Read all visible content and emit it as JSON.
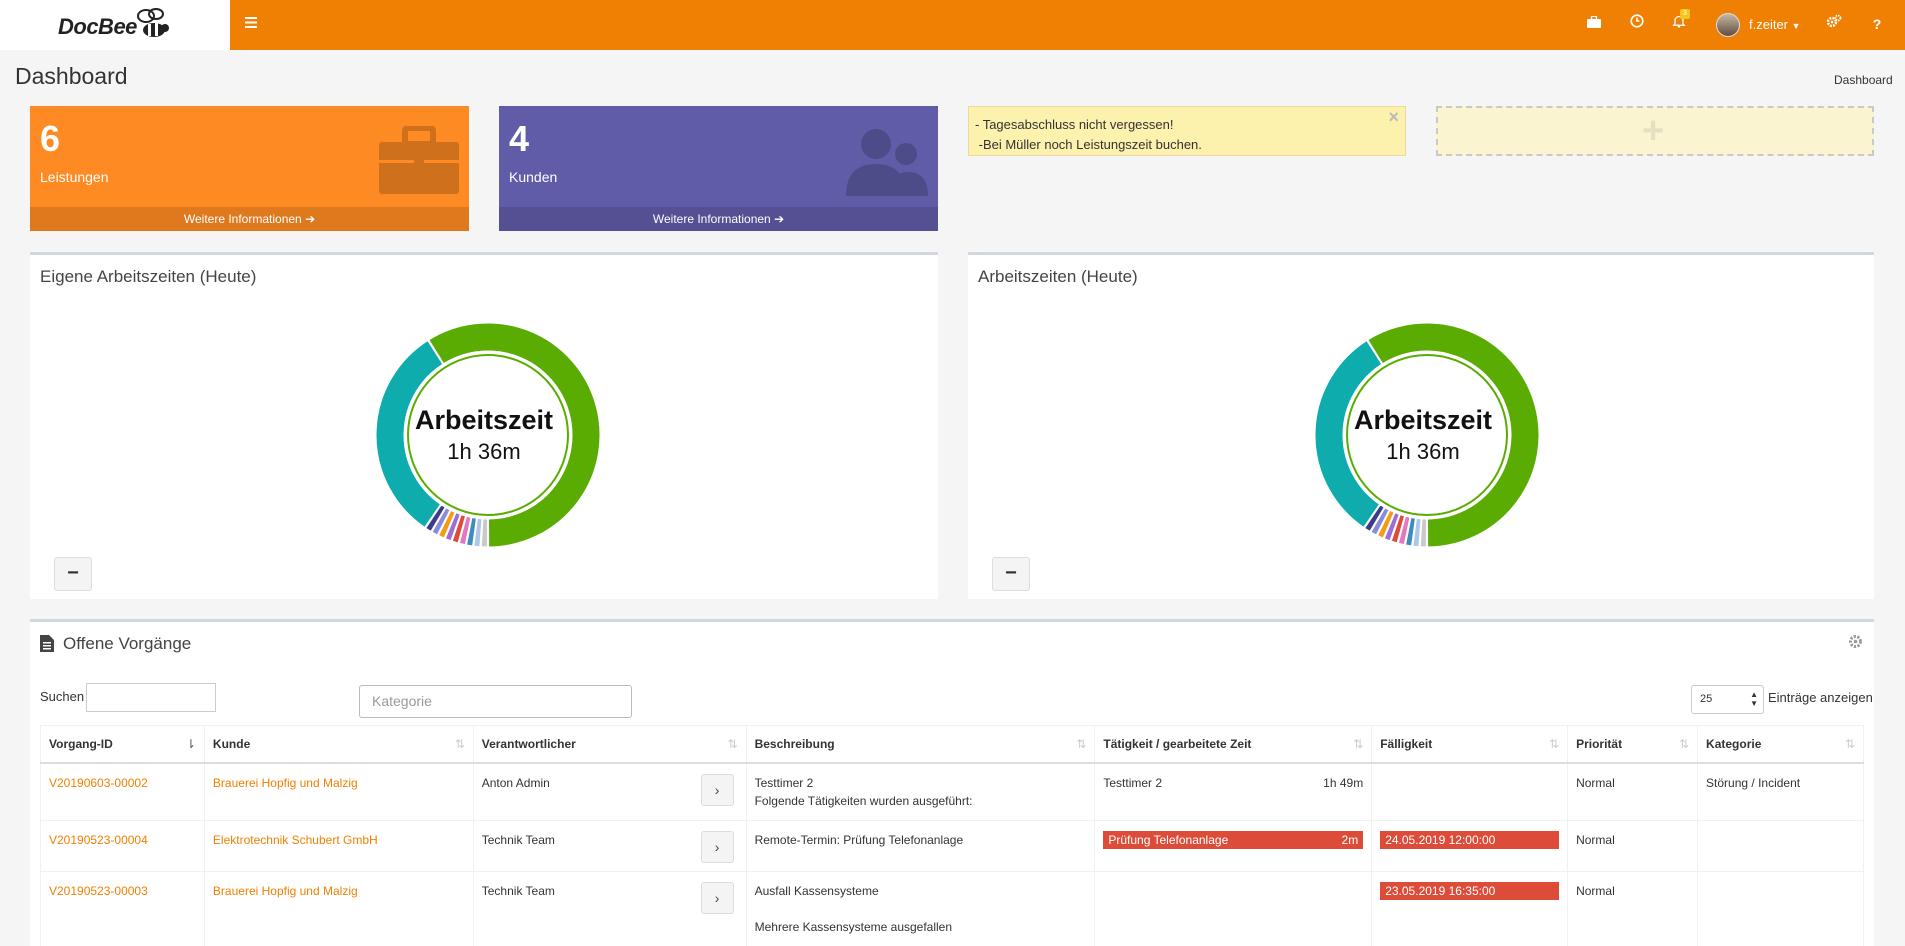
{
  "brand": {
    "logo_text": "DocBee"
  },
  "topbar": {
    "notification_count": "3",
    "user_name": "f.zeiter"
  },
  "page": {
    "title": "Dashboard",
    "breadcrumb": "Dashboard"
  },
  "small_boxes": [
    {
      "number": "6",
      "label": "Leistungen",
      "footer": "Weitere Informationen",
      "icon": "briefcase-icon",
      "color": "#fe8a23"
    },
    {
      "number": "4",
      "label": "Kunden",
      "footer": "Weitere Informationen",
      "icon": "users-icon",
      "color": "#605ca8"
    }
  ],
  "note": {
    "line1": "- Tagesabschluss nicht vergessen!",
    "line2": " -Bei Müller noch Leistungszeit buchen.",
    "close": "×"
  },
  "add_widget": {
    "symbol": "+"
  },
  "charts": [
    {
      "title": "Eigene Arbeitszeiten (Heute)",
      "center_title": "Arbeitszeit",
      "center_value": "1h 36m",
      "collapse": "−"
    },
    {
      "title": "Arbeitszeiten (Heute)",
      "center_title": "Arbeitszeit",
      "center_value": "1h 36m",
      "collapse": "−"
    }
  ],
  "chart_data": {
    "type": "pie",
    "donut": true,
    "slices": [
      {
        "color": "#5aac03",
        "value": 56
      },
      {
        "color": "#0eacac",
        "value": 30
      },
      {
        "color": "#3c3c8c",
        "value": 1
      },
      {
        "color": "#8a8adb",
        "value": 1
      },
      {
        "color": "#f39c12",
        "value": 1
      },
      {
        "color": "#9b6fd6",
        "value": 1
      },
      {
        "color": "#dd4b39",
        "value": 1
      },
      {
        "color": "#e377c2",
        "value": 1
      },
      {
        "color": "#3c8dbc",
        "value": 1
      },
      {
        "color": "#aec7e8",
        "value": 1
      },
      {
        "color": "#c9c9c9",
        "value": 1
      }
    ]
  },
  "table_panel": {
    "title": "Offene Vorgänge",
    "search_label": "Suchen",
    "search_value": "",
    "kategorie_placeholder": "Kategorie",
    "page_length": "25",
    "page_length_label": "Einträge anzeigen",
    "columns": [
      "Vorgang-ID",
      "Kunde",
      "Verantwortlicher",
      "Beschreibung",
      "Tätigkeit / gearbeitete Zeit",
      "Fälligkeit",
      "Priorität",
      "Kategorie"
    ],
    "rows": [
      {
        "id": "V20190603-00002",
        "kunde": "Brauerei Hopfig und Malzig",
        "verantwortlicher": "Anton Admin",
        "beschreibung": [
          "Testtimer 2",
          "Folgende Tätigkeiten wurden ausgeführt:"
        ],
        "taetigkeit": "Testtimer 2",
        "zeit": "1h 49m",
        "taetigkeit_red": false,
        "faelligkeit": "",
        "prioritaet": "Normal",
        "kategorie": "Störung / Incident"
      },
      {
        "id": "V20190523-00004",
        "kunde": "Elektrotechnik Schubert GmbH",
        "verantwortlicher": "Technik Team",
        "beschreibung": [
          "Remote-Termin: Prüfung Telefonanlage"
        ],
        "taetigkeit": "Prüfung Telefonanlage",
        "zeit": "2m",
        "taetigkeit_red": true,
        "faelligkeit": "24.05.2019 12:00:00",
        "prioritaet": "Normal",
        "kategorie": ""
      },
      {
        "id": "V20190523-00003",
        "kunde": "Brauerei Hopfig und Malzig",
        "verantwortlicher": "Technik Team",
        "beschreibung": [
          "Ausfall Kassensysteme",
          "",
          "Mehrere Kassensysteme ausgefallen"
        ],
        "taetigkeit": "",
        "zeit": "",
        "taetigkeit_red": false,
        "faelligkeit": "23.05.2019 16:35:00",
        "prioritaet": "Normal",
        "kategorie": ""
      }
    ],
    "row_button": "›"
  }
}
